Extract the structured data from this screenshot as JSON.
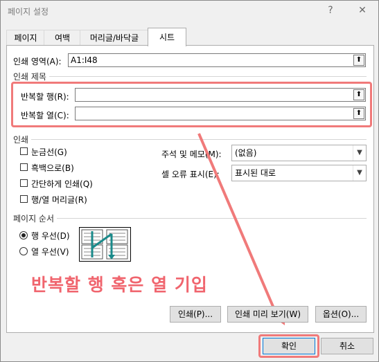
{
  "window": {
    "title": "페이지 설정",
    "help_glyph": "?",
    "close_glyph": "✕",
    "collapse_glyph": "⬆"
  },
  "tabs": [
    {
      "label": "페이지"
    },
    {
      "label": "여백"
    },
    {
      "label": "머리글/바닥글"
    },
    {
      "label": "시트",
      "active": true
    }
  ],
  "print_area": {
    "label": "인쇄 영역(A):",
    "value": "A1:I48"
  },
  "print_titles": {
    "header": "인쇄 제목",
    "rows_label": "반복할 행(R):",
    "rows_value": "",
    "cols_label": "반복할 열(C):",
    "cols_value": ""
  },
  "print": {
    "header": "인쇄",
    "checkboxes": [
      {
        "label": "눈금선(G)",
        "checked": false
      },
      {
        "label": "흑백으로(B)",
        "checked": false
      },
      {
        "label": "간단하게 인쇄(Q)",
        "checked": false
      },
      {
        "label": "행/열 머리글(R)",
        "checked": false
      }
    ],
    "comments_label": "주석 및 메모(M):",
    "comments_value": "(없음)",
    "errors_label": "셀 오류 표시(E):",
    "errors_value": "표시된 대로"
  },
  "page_order": {
    "header": "페이지 순서",
    "options": [
      {
        "label": "행 우선(D)",
        "selected": true
      },
      {
        "label": "열 우선(V)",
        "selected": false
      }
    ]
  },
  "annotation": "반복할 행 혹은 열 기입",
  "action_buttons": {
    "print": "인쇄(P)...",
    "preview": "인쇄 미리 보기(W)",
    "options": "옵션(O)..."
  },
  "footer_buttons": {
    "ok": "확인",
    "cancel": "취소"
  },
  "colors": {
    "highlight": "#f07a7a",
    "annotation_text": "#f0656e",
    "order_icon_arrow": "#1a8a8a"
  }
}
